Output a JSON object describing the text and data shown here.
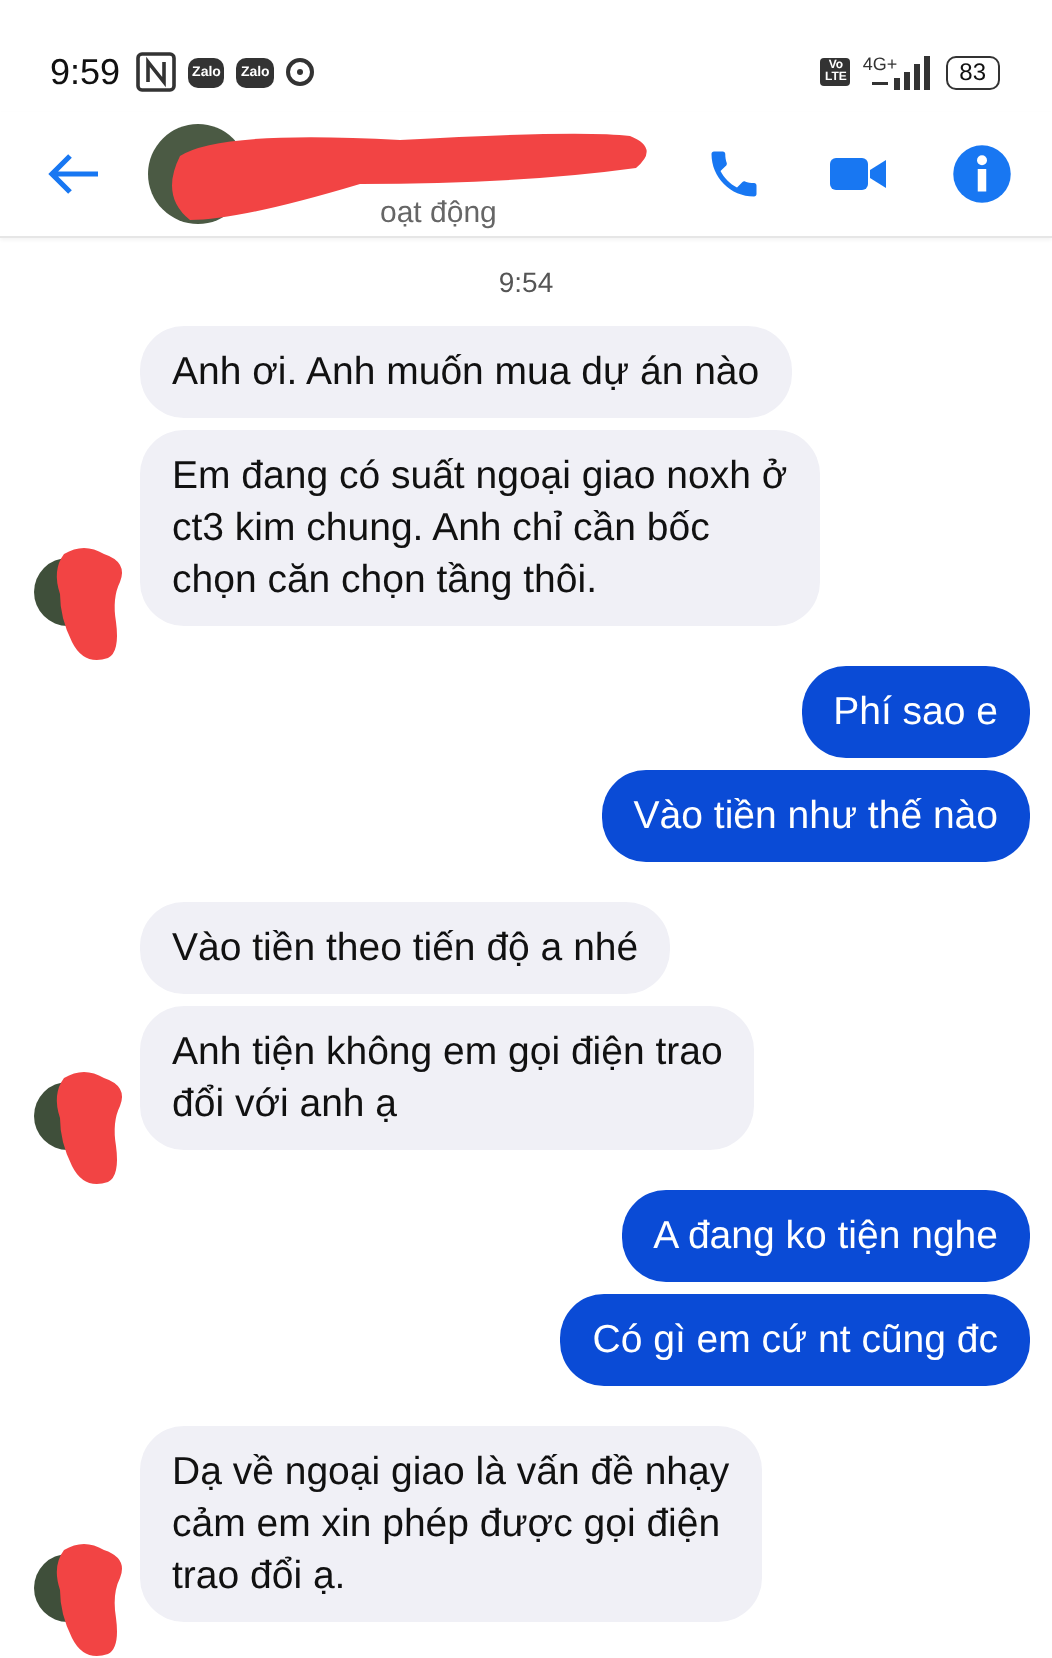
{
  "status_bar": {
    "time": "9:59",
    "notifications": [
      "Zalo",
      "Zalo"
    ],
    "volte": [
      "Vo",
      "LTE"
    ],
    "network": "4G+",
    "battery": "83"
  },
  "header": {
    "status": "oạt động"
  },
  "timestamp": "9:54",
  "groups": [
    {
      "kind": "incoming",
      "messages": [
        "Anh ơi. Anh muốn mua dự án nào",
        "Em đang có suất ngoại giao noxh ở\nct3 kim chung. Anh chỉ cần bốc\nchọn căn chọn tầng thôi."
      ]
    },
    {
      "kind": "outgoing",
      "messages": [
        "Phí sao e",
        "Vào tiền như thế nào"
      ]
    },
    {
      "kind": "incoming",
      "messages": [
        "Vào tiền theo tiến độ a nhé",
        "Anh tiện không em gọi điện trao\nđổi với anh ạ"
      ]
    },
    {
      "kind": "outgoing",
      "messages": [
        "A đang ko tiện nghe",
        "Có gì em cứ nt cũng đc"
      ]
    },
    {
      "kind": "incoming",
      "messages": [
        "Dạ về ngoại giao là vấn đề nhạy\ncảm em xin phép được gọi điện\ntrao đổi ạ."
      ]
    }
  ]
}
